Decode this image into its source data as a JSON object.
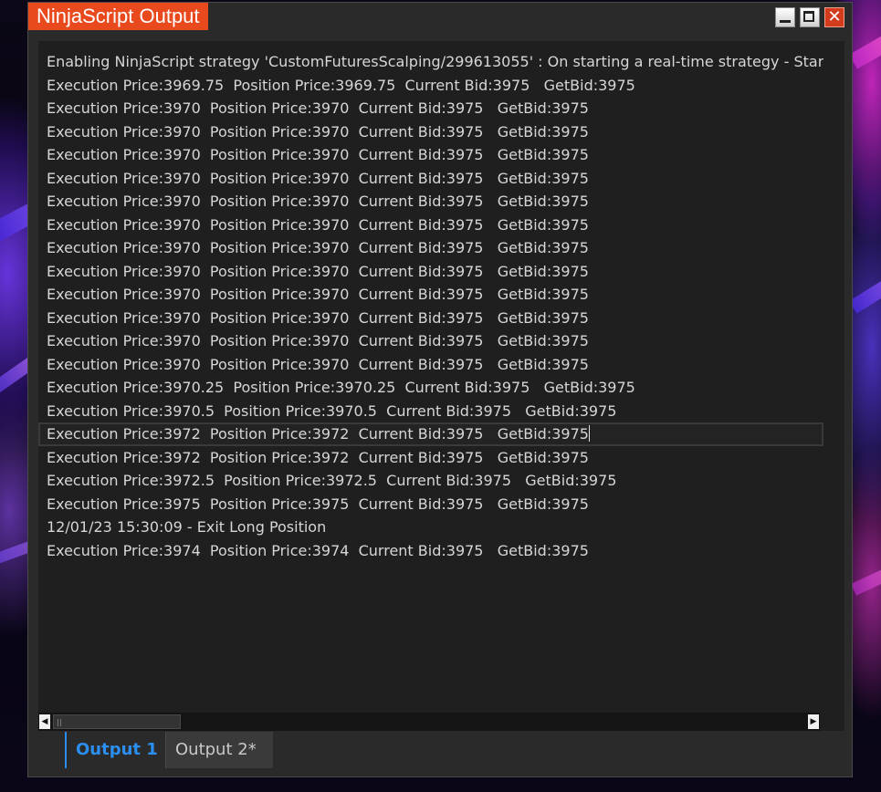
{
  "window": {
    "title": "NinjaScript Output"
  },
  "log_lines": [
    "Enabling NinjaScript strategy 'CustomFuturesScalping/299613055' : On starting a real-time strategy - Start",
    "Execution Price:3969.75  Position Price:3969.75  Current Bid:3975   GetBid:3975",
    "Execution Price:3970  Position Price:3970  Current Bid:3975   GetBid:3975",
    "Execution Price:3970  Position Price:3970  Current Bid:3975   GetBid:3975",
    "Execution Price:3970  Position Price:3970  Current Bid:3975   GetBid:3975",
    "Execution Price:3970  Position Price:3970  Current Bid:3975   GetBid:3975",
    "Execution Price:3970  Position Price:3970  Current Bid:3975   GetBid:3975",
    "Execution Price:3970  Position Price:3970  Current Bid:3975   GetBid:3975",
    "Execution Price:3970  Position Price:3970  Current Bid:3975   GetBid:3975",
    "Execution Price:3970  Position Price:3970  Current Bid:3975   GetBid:3975",
    "Execution Price:3970  Position Price:3970  Current Bid:3975   GetBid:3975",
    "Execution Price:3970  Position Price:3970  Current Bid:3975   GetBid:3975",
    "Execution Price:3970  Position Price:3970  Current Bid:3975   GetBid:3975",
    "Execution Price:3970  Position Price:3970  Current Bid:3975   GetBid:3975",
    "Execution Price:3970.25  Position Price:3970.25  Current Bid:3975   GetBid:3975",
    "Execution Price:3970.5  Position Price:3970.5  Current Bid:3975   GetBid:3975",
    "Execution Price:3972  Position Price:3972  Current Bid:3975   GetBid:3975",
    "Execution Price:3972  Position Price:3972  Current Bid:3975   GetBid:3975",
    "Execution Price:3972.5  Position Price:3972.5  Current Bid:3975   GetBid:3975",
    "Execution Price:3975  Position Price:3975  Current Bid:3975   GetBid:3975",
    "12/01/23 15:30:09 - Exit Long Position",
    "Execution Price:3974  Position Price:3974  Current Bid:3975   GetBid:3975"
  ],
  "selected_line_index": 16,
  "tabs": [
    {
      "label": "Output 1",
      "active": true
    },
    {
      "label": "Output 2*",
      "active": false
    }
  ],
  "colors": {
    "title_accent": "#e8491d",
    "active_tab_text": "#2a8ff0",
    "log_text": "#d6d6d6",
    "panel_bg": "#1f1f1f"
  },
  "icons": {
    "minimize": "minimize-icon",
    "maximize": "maximize-icon",
    "close": "close-icon",
    "scroll_left": "arrow-left-icon",
    "scroll_right": "arrow-right-icon"
  }
}
